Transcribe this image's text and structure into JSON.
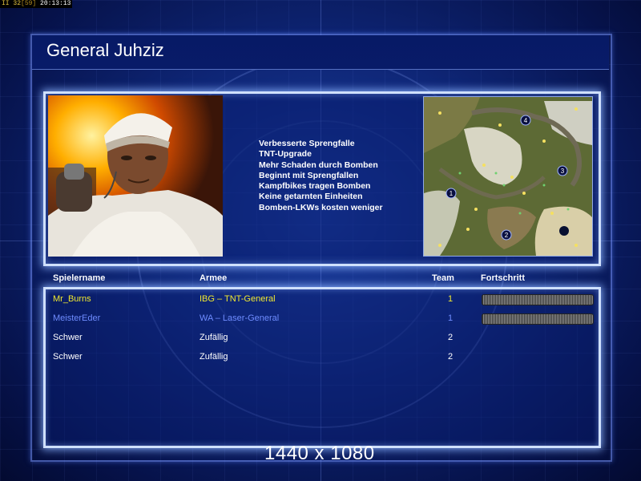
{
  "overlay": {
    "fps": "32",
    "fps_detail": "[59]",
    "clock": "20:13:13",
    "hud_icon": "II"
  },
  "screen": {
    "title": "General Juhziz"
  },
  "general": {
    "features": [
      "Verbesserte Sprengfalle",
      "TNT-Upgrade",
      "Mehr Schaden durch Bomben",
      "Beginnt mit Sprengfallen",
      "Kampfbikes tragen Bomben",
      "Keine getarnten Einheiten",
      "Bomben-LKWs kosten weniger"
    ]
  },
  "minimap": {
    "spawn_labels": [
      "4",
      "3",
      "1",
      "2"
    ]
  },
  "table": {
    "headers": {
      "name": "Spielername",
      "army": "Armee",
      "team": "Team",
      "progress": "Fortschritt"
    },
    "rows": [
      {
        "name": "Mr_Burns",
        "army": "IBG – TNT-General",
        "team": "1",
        "color": "#f0e830",
        "progress": 1.0
      },
      {
        "name": "MeisterEder",
        "army": "WA – Laser-General",
        "team": "1",
        "color": "#6f8cff",
        "progress": 1.0
      },
      {
        "name": "Schwer",
        "army": "Zufällig",
        "team": "2",
        "color": "#ffffff",
        "progress": null
      },
      {
        "name": "Schwer",
        "army": "Zufällig",
        "team": "2",
        "color": "#ffffff",
        "progress": null
      }
    ]
  },
  "footer": {
    "resolution": "1440 x 1080"
  }
}
